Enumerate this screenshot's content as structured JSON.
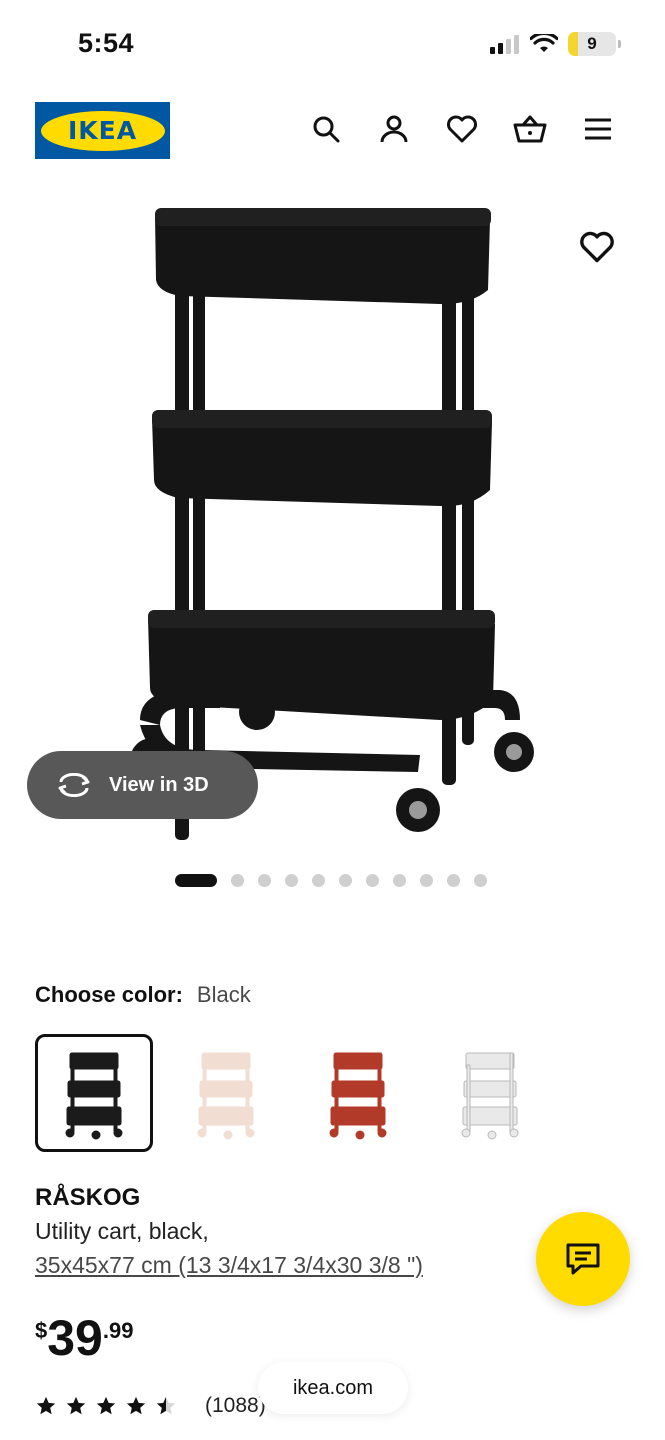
{
  "status_bar": {
    "time": "5:54",
    "battery": "9",
    "icons": [
      "cellular-signal-icon",
      "wifi-icon",
      "battery-icon"
    ]
  },
  "header": {
    "logo_text": "IKEA",
    "logo_colors": {
      "blue": "#0058a3",
      "yellow": "#ffdb00"
    },
    "icons": [
      "search-icon",
      "account-icon",
      "heart-icon",
      "basket-icon",
      "menu-icon"
    ]
  },
  "gallery": {
    "view_3d_label": "View in 3D",
    "image_count": 11,
    "active_index": 0,
    "favorite_icon": "heart-icon"
  },
  "color_picker": {
    "label": "Choose color:",
    "selected_value": "Black",
    "options": [
      {
        "name": "black",
        "color": "#1b1b1b",
        "selected": true
      },
      {
        "name": "pink",
        "color": "#f1ddd2",
        "selected": false
      },
      {
        "name": "red",
        "color": "#b23a28",
        "selected": false
      },
      {
        "name": "white",
        "color": "#e9e9e9",
        "selected": false
      }
    ]
  },
  "product": {
    "name": "RÅSKOG",
    "description": "Utility cart, black,",
    "size": "35x45x77 cm (13 3/4x17 3/4x30 3/8 \")",
    "price": {
      "currency": "$",
      "integer": "39",
      "decimal": ".99"
    },
    "rating": {
      "stars": 4.5,
      "count": "(1088)"
    }
  },
  "chat": {
    "icon": "chat-icon",
    "color": "#ffdb00"
  },
  "browser": {
    "url": "ikea.com"
  }
}
